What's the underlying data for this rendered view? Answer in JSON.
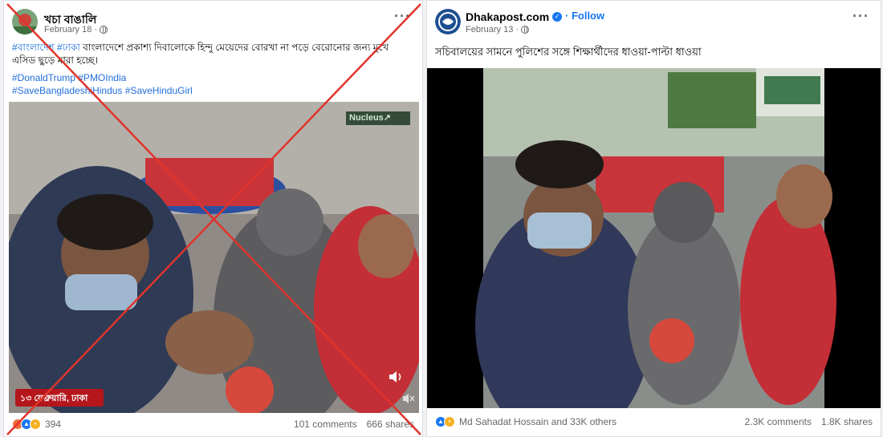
{
  "left_post": {
    "author": "খচা বাঙালি",
    "date": "February 18 ·",
    "more_label": "···",
    "caption_line1_tag1": "#বাংলাদেশ",
    "caption_line1_tag2": "#ঢাকা",
    "caption_line1_text": " বাংলাদেশে প্রকাশ্য দিবালোকে হিন্দু মেয়েদের বোরখা না পড়ে বেরোনোর জন্য মুখে",
    "caption_line2_text": "এসিড ছুড়ে মারা হচ্ছে।",
    "hashtag_line1": "#DonaldTrump #PMOIndia",
    "hashtag_line2": "#SaveBangladeshiHindus #SaveHinduGirl",
    "video_watermark": "Nucleus↗",
    "video_overlay_text": "১৩ ফেব্রুয়ারি, ঢাকা",
    "reaction_count": "394",
    "comments": "101 comments",
    "shares": "666 shares",
    "cross_color": "#e0342c"
  },
  "right_post": {
    "author": "Dhakapost.com",
    "follow_label": "Follow",
    "date": "February 13 ·",
    "more_label": "···",
    "caption": "সচিবালয়ের সামনে পুলিশের সঙ্গে শিক্ষার্থীদের ধাওয়া-পাল্টা ধাওয়া",
    "reaction_names": "Md Sahadat Hossain and 33K others",
    "comments": "2.3K comments",
    "shares": "1.8K shares",
    "verified_color": "#1877f2"
  },
  "icons": [
    "globe-icon",
    "more-options-icon",
    "verified-badge-icon",
    "like-reaction-icon",
    "angry-reaction-icon",
    "sad-reaction-icon",
    "haha-reaction-icon",
    "volume-icon",
    "mute-icon",
    "red-cross-mark"
  ]
}
